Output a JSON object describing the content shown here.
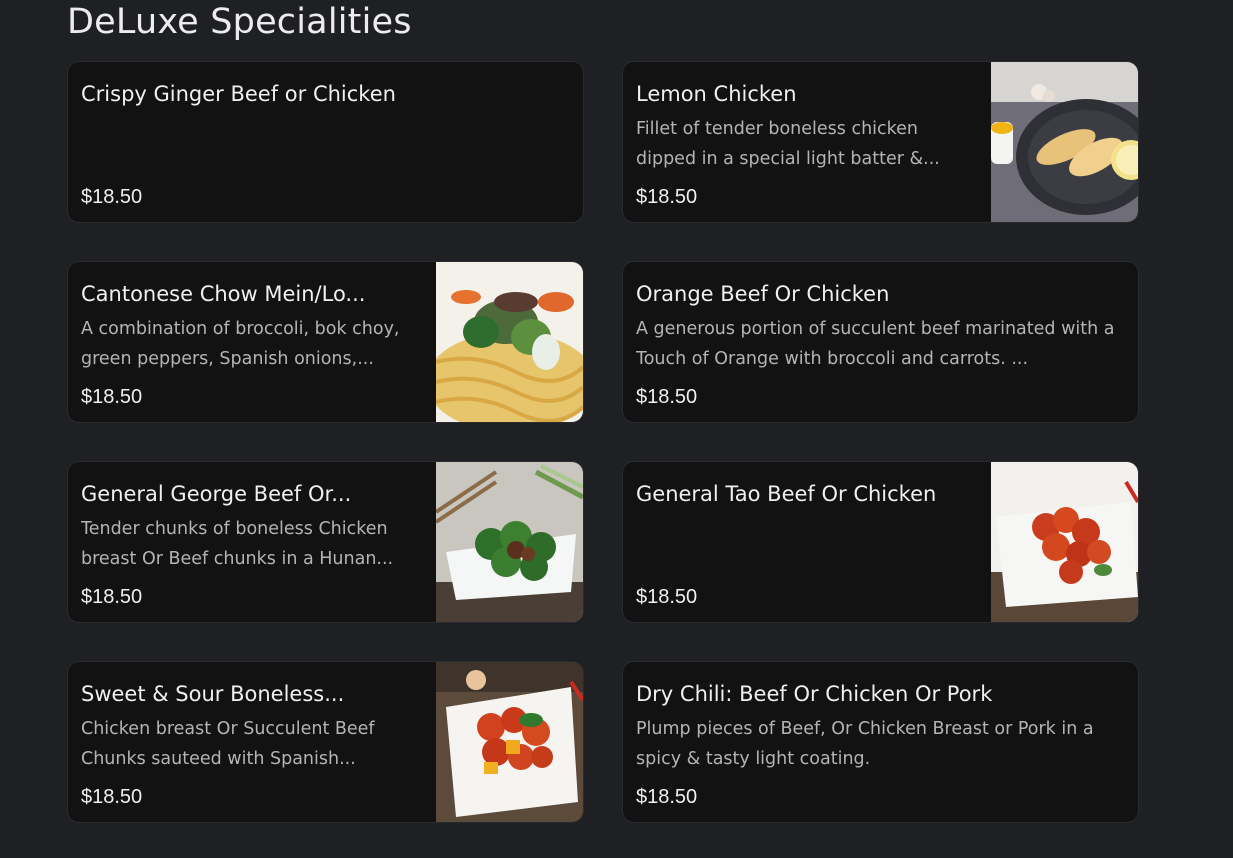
{
  "section": {
    "title": "DeLuxe Specialities"
  },
  "items": [
    {
      "name": "Crispy Ginger Beef or Chicken",
      "description": "",
      "price": "$18.50",
      "image": "none"
    },
    {
      "name": "Lemon Chicken",
      "description": "Fillet of tender boneless chicken dipped in a special light batter &...",
      "price": "$18.50",
      "image": "lemon-chicken-photo"
    },
    {
      "name": "Cantonese Chow Mein/Lo...",
      "description": "A combination of broccoli, bok choy, green peppers, Spanish onions,...",
      "price": "$18.50",
      "image": "chow-mein-photo"
    },
    {
      "name": "Orange Beef Or Chicken",
      "description": "A generous portion of succulent beef marinated with a Touch of Orange with broccoli and carrots. ...",
      "price": "$18.50",
      "image": "none"
    },
    {
      "name": "General George Beef Or...",
      "description": "Tender chunks of boneless Chicken breast Or Beef chunks in a Hunan...",
      "price": "$18.50",
      "image": "broccoli-beef-photo"
    },
    {
      "name": "General Tao Beef Or Chicken",
      "description": "",
      "price": "$18.50",
      "image": "general-tao-photo"
    },
    {
      "name": "Sweet & Sour Boneless...",
      "description": "Chicken breast Or Succulent Beef Chunks sauteed with Spanish...",
      "price": "$18.50",
      "image": "sweet-sour-photo"
    },
    {
      "name": "Dry Chili: Beef Or Chicken Or Pork",
      "description": "Plump pieces of Beef, Or Chicken Breast or Pork in a spicy & tasty light coating.",
      "price": "$18.50",
      "image": "none"
    }
  ],
  "colors": {
    "background": "#1f2023",
    "card": "#121212",
    "text": "#f0f0f0",
    "muted": "#b4b4b4"
  }
}
